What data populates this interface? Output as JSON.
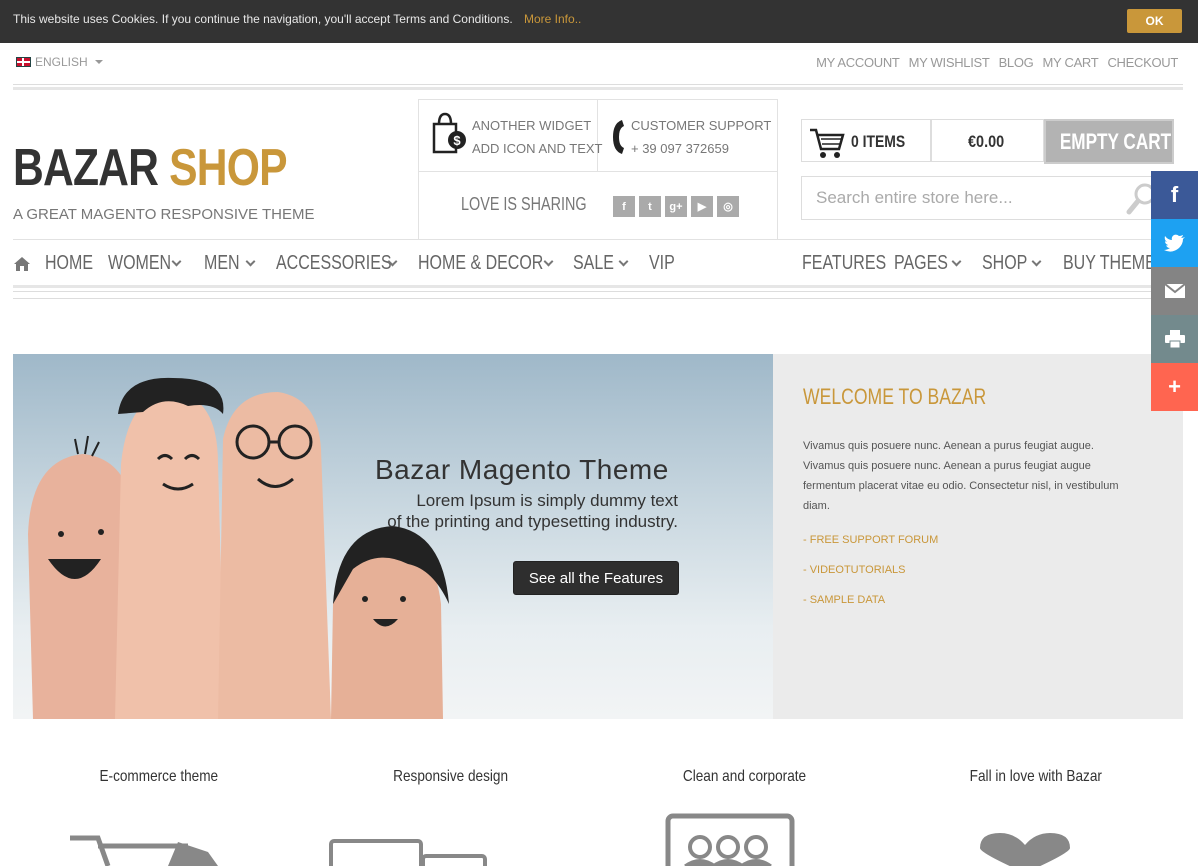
{
  "cookie": {
    "message": "This website uses Cookies. If you continue the navigation, you'll accept Terms and Conditions.",
    "more_info": "More Info..",
    "ok": "OK"
  },
  "language": "ENGLISH",
  "top_links": [
    "MY ACCOUNT",
    "MY WISHLIST",
    "BLOG",
    "MY CART",
    "CHECKOUT"
  ],
  "logo": {
    "part1": "BAZAR",
    "part2": "SHOP",
    "tagline": "A GREAT MAGENTO RESPONSIVE THEME"
  },
  "widget": {
    "line1": "ANOTHER WIDGET",
    "line2": "ADD ICON AND TEXT"
  },
  "support": {
    "line1": "CUSTOMER SUPPORT",
    "line2": "+ 39 097 372659"
  },
  "sharing": {
    "label": "LOVE IS SHARING",
    "icons": [
      "facebook-icon",
      "twitter-icon",
      "google-plus-icon",
      "youtube-icon",
      "instagram-icon"
    ]
  },
  "cart": {
    "items": "0 ITEMS",
    "total": "€0.00",
    "empty": "EMPTY CART"
  },
  "search": {
    "placeholder": "Search entire store here..."
  },
  "nav_left": [
    {
      "label": "HOME",
      "dropdown": false
    },
    {
      "label": "WOMEN",
      "dropdown": true
    },
    {
      "label": "MEN",
      "dropdown": true
    },
    {
      "label": "ACCESSORIES",
      "dropdown": true
    },
    {
      "label": "HOME & DECOR",
      "dropdown": true
    },
    {
      "label": "SALE",
      "dropdown": true
    },
    {
      "label": "VIP",
      "dropdown": false
    }
  ],
  "nav_right": [
    {
      "label": "FEATURES",
      "dropdown": false
    },
    {
      "label": "PAGES",
      "dropdown": true
    },
    {
      "label": "SHOP",
      "dropdown": true
    },
    {
      "label": "BUY THEME",
      "dropdown": false
    }
  ],
  "hero": {
    "title": "Bazar Magento Theme",
    "subtitle_line1": "Lorem Ipsum is simply dummy text",
    "subtitle_line2": "of the printing and typesetting industry.",
    "button": "See all the Features"
  },
  "welcome": {
    "title": "WELCOME TO BAZAR",
    "text": "Vivamus quis posuere nunc. Aenean a purus feugiat augue. Vivamus quis posuere nunc. Aenean a purus feugiat augue fermentum placerat vitae eu odio. Consectetur nisl, in vestibulum diam.",
    "links": [
      "- FREE SUPPORT FORUM",
      "- VIDEOTUTORIALS",
      "- SAMPLE DATA"
    ]
  },
  "share_bar": [
    {
      "icon": "facebook-icon",
      "color": "#3b5998"
    },
    {
      "icon": "twitter-icon",
      "color": "#1da1f2"
    },
    {
      "icon": "email-icon",
      "color": "#848484"
    },
    {
      "icon": "print-icon",
      "color": "#738a8d"
    },
    {
      "icon": "plus-icon",
      "color": "#ff6550"
    }
  ],
  "features": [
    "E-commerce theme",
    "Responsive design",
    "Clean and corporate",
    "Fall in love with Bazar"
  ],
  "colors": {
    "accent": "#c9973a",
    "dark": "#333333",
    "cookie_bg": "#333333"
  }
}
